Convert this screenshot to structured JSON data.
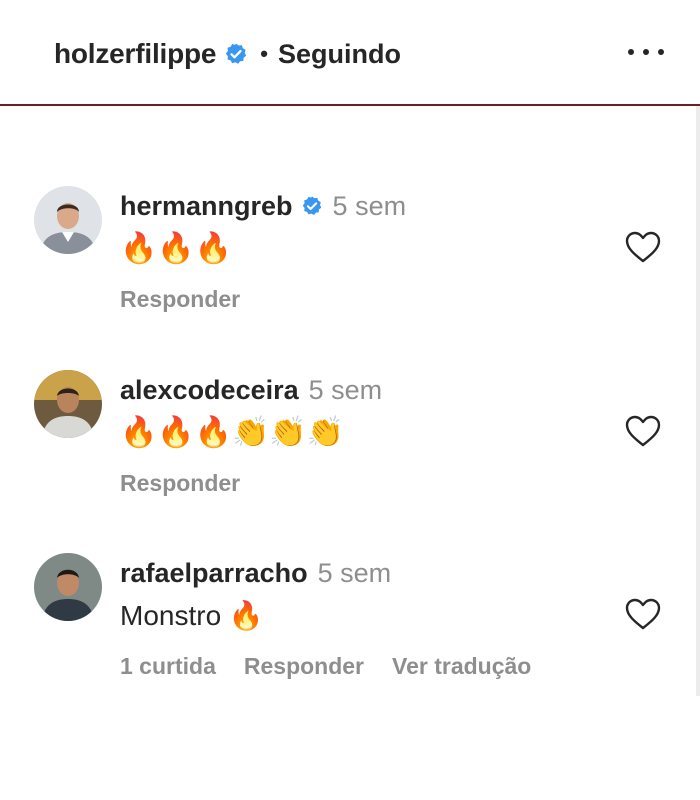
{
  "header": {
    "username": "holzerfilippe",
    "separator": "•",
    "follow_state": "Seguindo"
  },
  "comments": [
    {
      "username": "hermanngreb",
      "verified": true,
      "time": "5 sem",
      "text": "🔥🔥🔥",
      "actions": [
        "Responder"
      ]
    },
    {
      "username": "alexcodeceira",
      "verified": false,
      "time": "5 sem",
      "text": "🔥🔥🔥👏👏👏",
      "actions": [
        "Responder"
      ]
    },
    {
      "username": "rafaelparracho",
      "verified": false,
      "time": "5 sem",
      "text": "Monstro 🔥",
      "actions": [
        "1 curtida",
        "Responder",
        "Ver tradução"
      ]
    }
  ],
  "colors": {
    "verified_blue": "#3897f0",
    "text_primary": "#262626",
    "text_secondary": "#8e8e8e",
    "header_border": "#6b1f22"
  }
}
